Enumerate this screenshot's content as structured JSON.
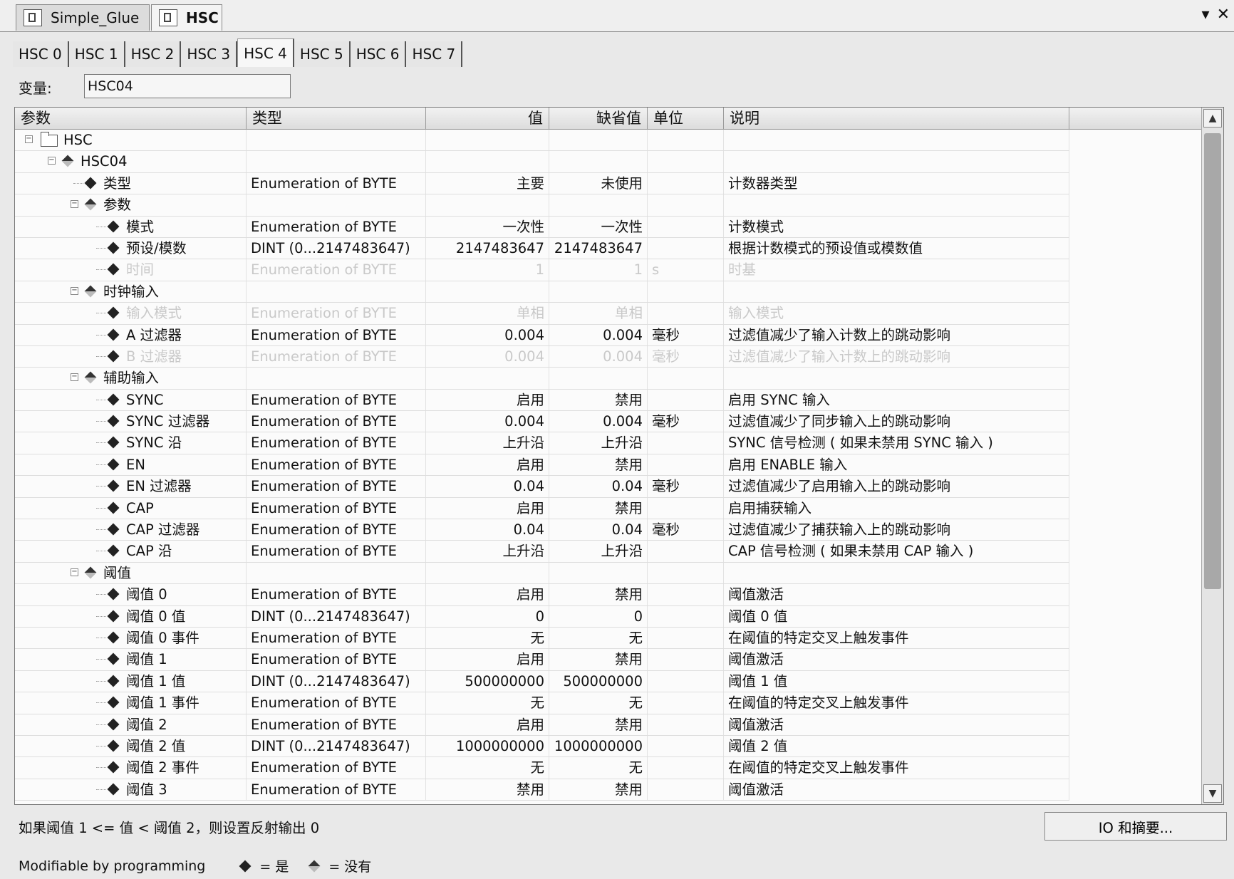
{
  "doc_tabs": [
    {
      "label": "Simple_Glue",
      "icon": "program-icon",
      "active": false
    },
    {
      "label": "HSC",
      "icon": "hardware-config-icon",
      "active": true
    }
  ],
  "sub_tabs": [
    "HSC 0",
    "HSC 1",
    "HSC 2",
    "HSC 3",
    "HSC 4",
    "HSC 5",
    "HSC 6",
    "HSC 7"
  ],
  "active_sub_tab": "HSC 4",
  "variable": {
    "label": "变量:",
    "value": "HSC04"
  },
  "grid": {
    "headers": {
      "param": "参数",
      "type": "类型",
      "value": "值",
      "default": "缺省值",
      "unit": "单位",
      "desc": "说明"
    },
    "rows": [
      {
        "level": 0,
        "kind": "folder",
        "param": "HSC",
        "type": "",
        "value": "",
        "default": "",
        "unit": "",
        "desc": "",
        "disabled": false
      },
      {
        "level": 1,
        "kind": "group",
        "param": "HSC04",
        "type": "",
        "value": "",
        "default": "",
        "unit": "",
        "desc": "",
        "disabled": false
      },
      {
        "level": 2,
        "kind": "leaf",
        "param": "类型",
        "type": "Enumeration of BYTE",
        "value": "主要",
        "default": "未使用",
        "unit": "",
        "desc": "计数器类型",
        "disabled": false
      },
      {
        "level": 2,
        "kind": "group",
        "param": "参数",
        "type": "",
        "value": "",
        "default": "",
        "unit": "",
        "desc": "",
        "disabled": false
      },
      {
        "level": 3,
        "kind": "leaf",
        "param": "模式",
        "type": "Enumeration of BYTE",
        "value": "一次性",
        "default": "一次性",
        "unit": "",
        "desc": "计数模式",
        "disabled": false
      },
      {
        "level": 3,
        "kind": "leaf",
        "param": "预设/模数",
        "type": "DINT (0...2147483647)",
        "value": "2147483647",
        "default": "2147483647",
        "unit": "",
        "desc": "根据计数模式的预设值或模数值",
        "disabled": false
      },
      {
        "level": 3,
        "kind": "leaf",
        "param": "时间",
        "type": "Enumeration of BYTE",
        "value": "1",
        "default": "1",
        "unit": "s",
        "desc": "时基",
        "disabled": true
      },
      {
        "level": 2,
        "kind": "group",
        "param": "时钟输入",
        "type": "",
        "value": "",
        "default": "",
        "unit": "",
        "desc": "",
        "disabled": false
      },
      {
        "level": 3,
        "kind": "leaf",
        "param": "输入模式",
        "type": "Enumeration of BYTE",
        "value": "单相",
        "default": "单相",
        "unit": "",
        "desc": "输入模式",
        "disabled": true
      },
      {
        "level": 3,
        "kind": "leaf",
        "param": "A 过滤器",
        "type": "Enumeration of BYTE",
        "value": "0.004",
        "default": "0.004",
        "unit": "毫秒",
        "desc": "过滤值减少了输入计数上的跳动影响",
        "disabled": false
      },
      {
        "level": 3,
        "kind": "leaf",
        "param": "B 过滤器",
        "type": "Enumeration of BYTE",
        "value": "0.004",
        "default": "0.004",
        "unit": "毫秒",
        "desc": "过滤值减少了输入计数上的跳动影响",
        "disabled": true
      },
      {
        "level": 2,
        "kind": "group",
        "param": "辅助输入",
        "type": "",
        "value": "",
        "default": "",
        "unit": "",
        "desc": "",
        "disabled": false
      },
      {
        "level": 3,
        "kind": "leaf",
        "param": "SYNC",
        "type": "Enumeration of BYTE",
        "value": "启用",
        "default": "禁用",
        "unit": "",
        "desc": "启用 SYNC 输入",
        "disabled": false
      },
      {
        "level": 3,
        "kind": "leaf",
        "param": "SYNC 过滤器",
        "type": "Enumeration of BYTE",
        "value": "0.004",
        "default": "0.004",
        "unit": "毫秒",
        "desc": "过滤值减少了同步输入上的跳动影响",
        "disabled": false
      },
      {
        "level": 3,
        "kind": "leaf",
        "param": "SYNC 沿",
        "type": "Enumeration of BYTE",
        "value": "上升沿",
        "default": "上升沿",
        "unit": "",
        "desc": "SYNC 信号检测 ( 如果未禁用 SYNC 输入 )",
        "disabled": false
      },
      {
        "level": 3,
        "kind": "leaf",
        "param": "EN",
        "type": "Enumeration of BYTE",
        "value": "启用",
        "default": "禁用",
        "unit": "",
        "desc": "启用 ENABLE 输入",
        "disabled": false
      },
      {
        "level": 3,
        "kind": "leaf",
        "param": "EN 过滤器",
        "type": "Enumeration of BYTE",
        "value": "0.04",
        "default": "0.04",
        "unit": "毫秒",
        "desc": "过滤值减少了启用输入上的跳动影响",
        "disabled": false
      },
      {
        "level": 3,
        "kind": "leaf",
        "param": "CAP",
        "type": "Enumeration of BYTE",
        "value": "启用",
        "default": "禁用",
        "unit": "",
        "desc": "启用捕获输入",
        "disabled": false
      },
      {
        "level": 3,
        "kind": "leaf",
        "param": "CAP 过滤器",
        "type": "Enumeration of BYTE",
        "value": "0.04",
        "default": "0.04",
        "unit": "毫秒",
        "desc": "过滤值减少了捕获输入上的跳动影响",
        "disabled": false
      },
      {
        "level": 3,
        "kind": "leaf",
        "param": "CAP 沿",
        "type": "Enumeration of BYTE",
        "value": "上升沿",
        "default": "上升沿",
        "unit": "",
        "desc": "CAP 信号检测 ( 如果未禁用 CAP 输入 )",
        "disabled": false
      },
      {
        "level": 2,
        "kind": "group",
        "param": "阈值",
        "type": "",
        "value": "",
        "default": "",
        "unit": "",
        "desc": "",
        "disabled": false
      },
      {
        "level": 3,
        "kind": "leaf",
        "param": "阈值 0",
        "type": "Enumeration of BYTE",
        "value": "启用",
        "default": "禁用",
        "unit": "",
        "desc": "阈值激活",
        "disabled": false
      },
      {
        "level": 3,
        "kind": "leaf",
        "param": "阈值 0 值",
        "type": "DINT (0...2147483647)",
        "value": "0",
        "default": "0",
        "unit": "",
        "desc": "阈值 0 值",
        "disabled": false
      },
      {
        "level": 3,
        "kind": "leaf",
        "param": "阈值 0 事件",
        "type": "Enumeration of BYTE",
        "value": "无",
        "default": "无",
        "unit": "",
        "desc": "在阈值的特定交叉上触发事件",
        "disabled": false
      },
      {
        "level": 3,
        "kind": "leaf",
        "param": "阈值 1",
        "type": "Enumeration of BYTE",
        "value": "启用",
        "default": "禁用",
        "unit": "",
        "desc": "阈值激活",
        "disabled": false
      },
      {
        "level": 3,
        "kind": "leaf",
        "param": "阈值 1 值",
        "type": "DINT (0...2147483647)",
        "value": "500000000",
        "default": "500000000",
        "unit": "",
        "desc": "阈值 1 值",
        "disabled": false
      },
      {
        "level": 3,
        "kind": "leaf",
        "param": "阈值 1 事件",
        "type": "Enumeration of BYTE",
        "value": "无",
        "default": "无",
        "unit": "",
        "desc": "在阈值的特定交叉上触发事件",
        "disabled": false
      },
      {
        "level": 3,
        "kind": "leaf",
        "param": "阈值 2",
        "type": "Enumeration of BYTE",
        "value": "启用",
        "default": "禁用",
        "unit": "",
        "desc": "阈值激活",
        "disabled": false
      },
      {
        "level": 3,
        "kind": "leaf",
        "param": "阈值 2 值",
        "type": "DINT (0...2147483647)",
        "value": "1000000000",
        "default": "1000000000",
        "unit": "",
        "desc": "阈值 2 值",
        "disabled": false
      },
      {
        "level": 3,
        "kind": "leaf",
        "param": "阈值 2 事件",
        "type": "Enumeration of BYTE",
        "value": "无",
        "default": "无",
        "unit": "",
        "desc": "在阈值的特定交叉上触发事件",
        "disabled": false
      },
      {
        "level": 3,
        "kind": "leaf",
        "param": "阈值 3",
        "type": "Enumeration of BYTE",
        "value": "禁用",
        "default": "禁用",
        "unit": "",
        "desc": "阈值激活",
        "disabled": false
      }
    ]
  },
  "hint_text": "如果阈值 1 <= 值 < 阈值 2，则设置反射输出 0",
  "io_button_label": "IO 和摘要...",
  "legend": {
    "label": "Modifiable by programming",
    "yes": "= 是",
    "no": "= 没有"
  }
}
